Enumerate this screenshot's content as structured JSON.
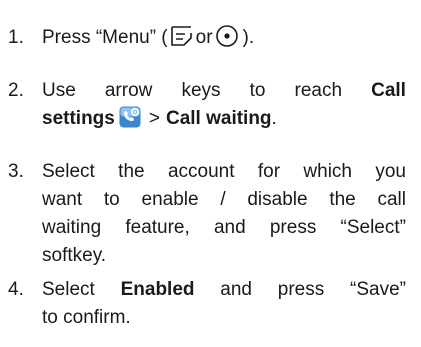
{
  "steps": [
    {
      "number": "1.",
      "text_before": "Press “Menu” (",
      "or": "or",
      "text_after": ")."
    },
    {
      "number": "2.",
      "line1": [
        "Use",
        "arrow",
        "keys",
        "to",
        "reach"
      ],
      "call_label": "Call",
      "settings_label": "settings",
      "separator": ">",
      "call_waiting_label": "Call waiting",
      "period": "."
    },
    {
      "number": "3.",
      "lines": [
        [
          "Select",
          "the",
          "account",
          "for",
          "which",
          "you"
        ],
        [
          "want",
          "to",
          "enable",
          "/",
          "disable",
          "the",
          "call"
        ],
        [
          "waiting",
          "feature,",
          "and",
          "press",
          "“Select”"
        ]
      ],
      "last_line": "softkey."
    },
    {
      "number": "4.",
      "select": "Select",
      "enabled_label": "Enabled",
      "line1_rest": [
        "and",
        "press",
        "“Save”"
      ],
      "line2": "to confirm."
    }
  ],
  "icons": {
    "menu_icon": "menu-softkey-icon",
    "ok_icon": "ok-button-icon",
    "settings_icon": "call-settings-icon",
    "settings_icon_color": "#3a86d1"
  }
}
